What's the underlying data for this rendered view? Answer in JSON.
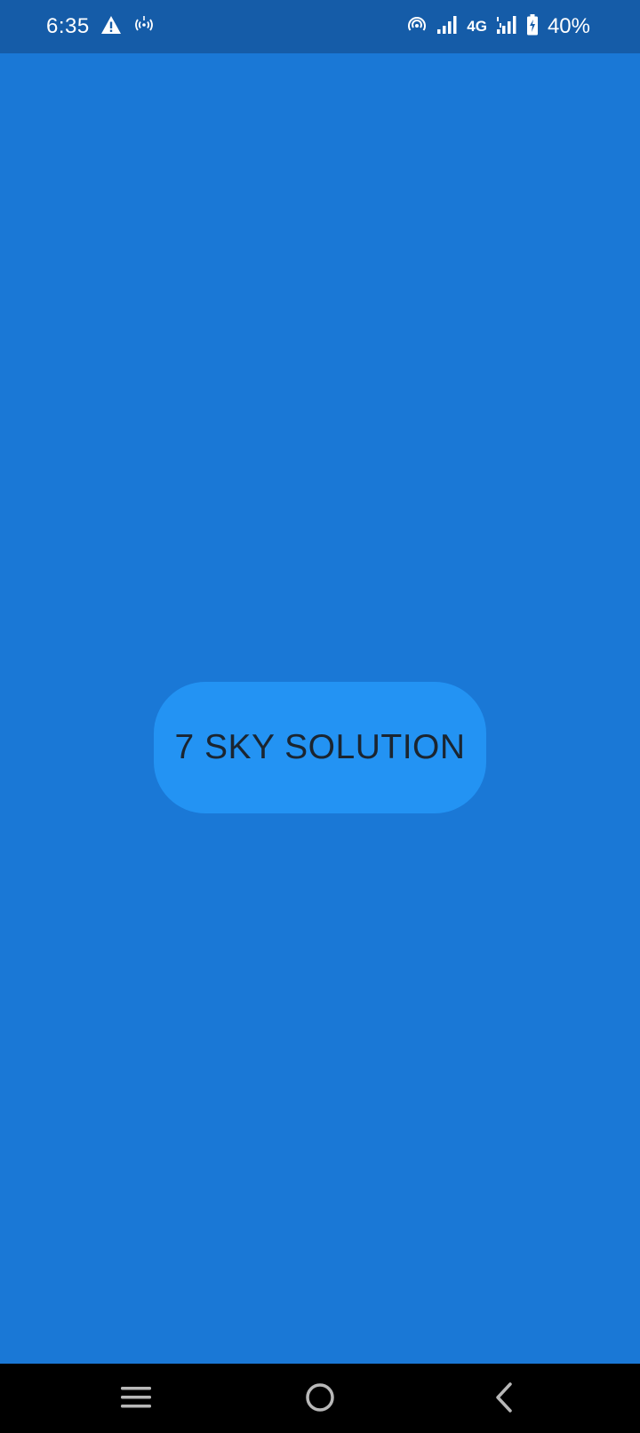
{
  "status_bar": {
    "time": "6:35",
    "icons_left": [
      "warning-icon",
      "wifi-calling-icon"
    ],
    "icons_right": [
      "hotspot-icon",
      "signal-icon",
      "signal-icon"
    ],
    "network_type": "4G",
    "battery_percent": "40%",
    "battery_charging": true
  },
  "main": {
    "brand_label": "7 SKY SOLUTION"
  },
  "nav_bar": {
    "buttons": [
      "recent-apps-icon",
      "home-icon",
      "back-icon"
    ]
  },
  "colors": {
    "status_bar_bg": "#155ca8",
    "main_bg": "#1a78d6",
    "pill_bg": "#2393f3",
    "pill_text": "#1b2530",
    "nav_bar_bg": "#000000"
  }
}
